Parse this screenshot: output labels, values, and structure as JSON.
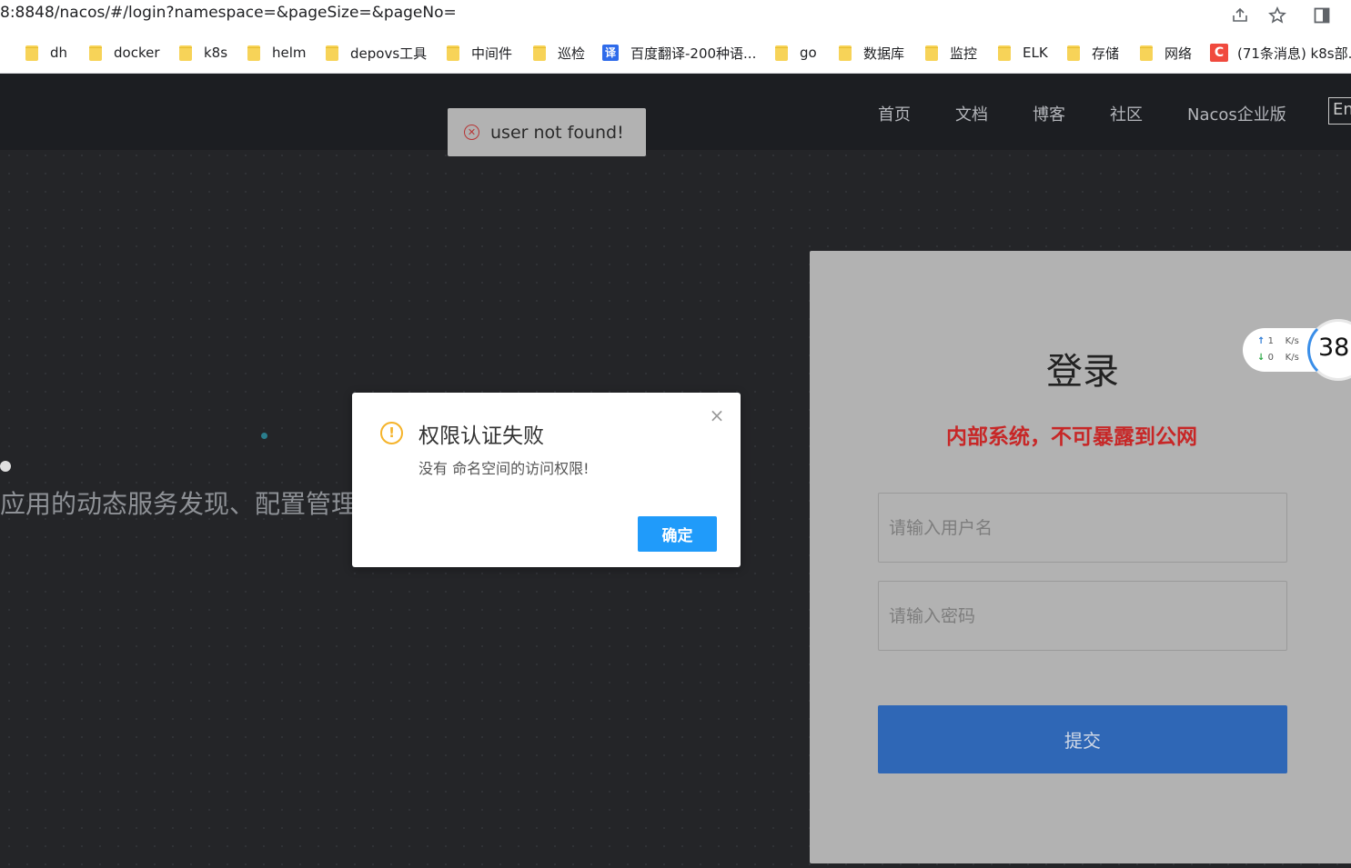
{
  "browser": {
    "url": "8:8848/nacos/#/login?namespace=&pageSize=&pageNo=",
    "icons": [
      "share-icon",
      "star-icon",
      "sidebar-icon"
    ],
    "bookmarks": [
      {
        "label": "dh",
        "icon": "folder-icon"
      },
      {
        "label": "docker",
        "icon": "folder-icon"
      },
      {
        "label": "k8s",
        "icon": "folder-icon"
      },
      {
        "label": "helm",
        "icon": "folder-icon"
      },
      {
        "label": "depovs工具",
        "icon": "folder-icon"
      },
      {
        "label": "中间件",
        "icon": "folder-icon"
      },
      {
        "label": "巡检",
        "icon": "folder-icon"
      },
      {
        "label": "百度翻译-200种语...",
        "icon": "baidu-translate-icon"
      },
      {
        "label": "go",
        "icon": "folder-icon"
      },
      {
        "label": "数据库",
        "icon": "folder-icon"
      },
      {
        "label": "监控",
        "icon": "folder-icon"
      },
      {
        "label": "ELK",
        "icon": "folder-icon"
      },
      {
        "label": "存储",
        "icon": "folder-icon"
      },
      {
        "label": "网络",
        "icon": "folder-icon"
      },
      {
        "label": "(71条消息) k8s部...",
        "icon": "csdn-icon"
      }
    ],
    "baidu_icon_glyph": "译",
    "csdn_icon_glyph": "C"
  },
  "header": {
    "nav": [
      "首页",
      "文档",
      "博客",
      "社区",
      "Nacos企业版"
    ],
    "lang": "En"
  },
  "hero": {
    "text": "应用的动态服务发现、配置管理"
  },
  "toast": {
    "message": "user not found!",
    "icon": "error-circle-icon"
  },
  "login": {
    "title": "登录",
    "warning": "内部系统，不可暴露到公网",
    "username_placeholder": "请输入用户名",
    "password_placeholder": "请输入密码",
    "submit_label": "提交"
  },
  "network_widget": {
    "upload": "1",
    "download": "0",
    "unit": "K/s",
    "percent": "38"
  },
  "modal": {
    "title": "权限认证失败",
    "message": "没有 命名空间的访问权限!",
    "ok_label": "确定",
    "icon": "warning-icon"
  }
}
